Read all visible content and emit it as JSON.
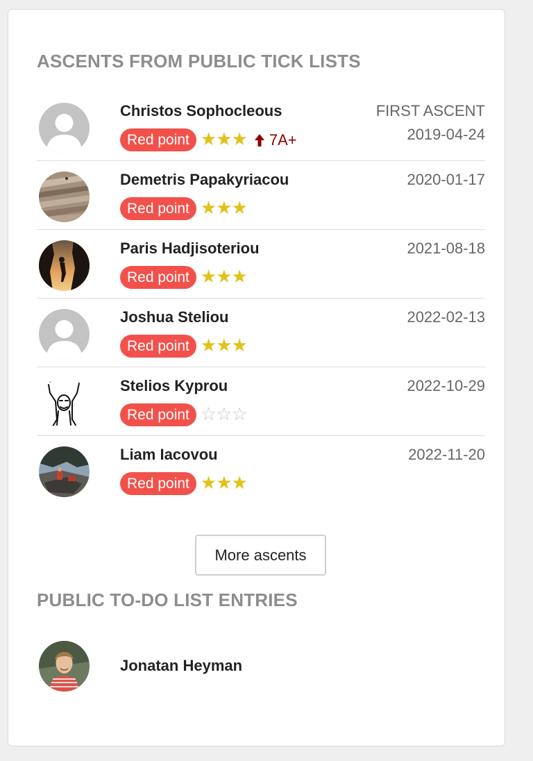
{
  "ascents_section": {
    "title": "ASCENTS FROM PUBLIC TICK LISTS",
    "rows": [
      {
        "name": "Christos Sophocleous",
        "style": "Red point",
        "stars": "★★★",
        "grade": "7A+",
        "label": "FIRST ASCENT",
        "date": "2019-04-24",
        "avatar": "default-avatar"
      },
      {
        "name": "Demetris Papakyriacou",
        "style": "Red point",
        "stars": "★★★",
        "date": "2020-01-17",
        "avatar": "rock-photo-avatar"
      },
      {
        "name": "Paris Hadjisoteriou",
        "style": "Red point",
        "stars": "★★★",
        "date": "2021-08-18",
        "avatar": "silhouette-photo-avatar"
      },
      {
        "name": "Joshua Steliou",
        "style": "Red point",
        "stars": "★★★",
        "date": "2022-02-13",
        "avatar": "default-avatar"
      },
      {
        "name": "Stelios Kyprou",
        "style": "Red point",
        "stars": "☆☆☆",
        "date": "2022-10-29",
        "avatar": "drawing-avatar"
      },
      {
        "name": "Liam Iacovou",
        "style": "Red point",
        "stars": "★★★",
        "date": "2022-11-20",
        "avatar": "outdoor-photo-avatar"
      }
    ],
    "more_button_label": "More ascents"
  },
  "todo_section": {
    "title": "PUBLIC TO-DO LIST ENTRIES",
    "entries": [
      {
        "name": "Jonatan Heyman",
        "avatar": "portrait-photo-avatar"
      }
    ]
  },
  "colors": {
    "badge": "#f2514b",
    "star_filled": "#e2c217",
    "star_empty": "#c7c7c7",
    "grade": "#8e0000",
    "section_title": "#8d8d8d"
  },
  "icons": {
    "grade_change": "arrow-up-icon"
  }
}
